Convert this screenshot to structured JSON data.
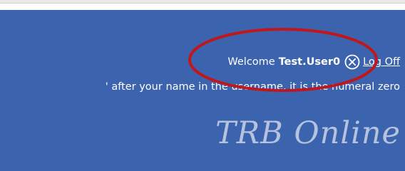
{
  "header": {
    "welcome_label": "Welcome",
    "username": "Test.User0",
    "logoff_label": "Log Off",
    "logoff_icon": "close-circle-icon",
    "hint": "' after your name in the username, it is the numeral zero",
    "brand": "TRB Online"
  },
  "colors": {
    "header_background": "#3c63ad",
    "text": "#ffffff",
    "brand_text": "#b6c3de",
    "highlight_ring": "#c0171c"
  }
}
